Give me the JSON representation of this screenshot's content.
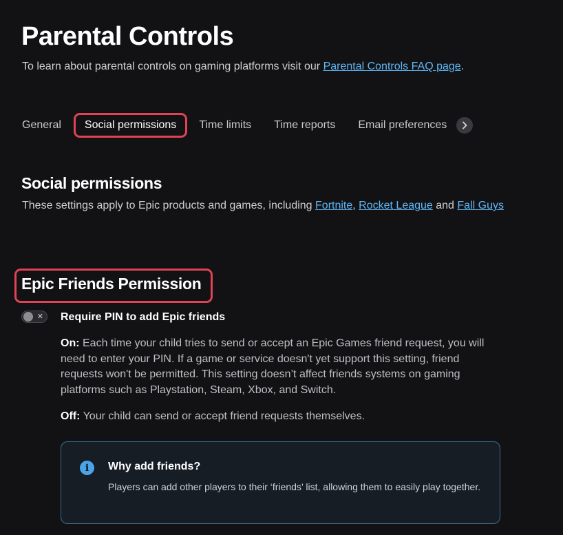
{
  "header": {
    "title": "Parental Controls",
    "intro_text": "To learn about parental controls on gaming platforms visit our ",
    "intro_link": "Parental Controls FAQ page",
    "intro_end": "."
  },
  "tabs": [
    {
      "label": "General",
      "active": false
    },
    {
      "label": "Social permissions",
      "active": true
    },
    {
      "label": "Time limits",
      "active": false
    },
    {
      "label": "Time reports",
      "active": false
    },
    {
      "label": "Email preferences",
      "active": false
    }
  ],
  "tab_next_icon": "chevron-right-icon",
  "social": {
    "title": "Social permissions",
    "desc_prefix": "These settings apply to Epic products and games, including ",
    "link_fortnite": "Fortnite",
    "sep_comma": ", ",
    "link_rocket_league": "Rocket League",
    "sep_and": " and ",
    "link_fall_guys": "Fall Guys"
  },
  "epic_friends": {
    "title": "Epic Friends Permission",
    "toggle_label": "Require PIN to add Epic friends",
    "toggle_state": "off",
    "on_label": "On:",
    "on_text": " Each time your child tries to send or accept an Epic Games friend request, you will need to enter your PIN. If a game or service doesn't yet support this setting, friend requests won't be permitted. This setting doesn’t affect friends systems on gaming platforms such as Playstation, Steam, Xbox, and Switch.",
    "off_label": "Off:",
    "off_text": " Your child can send or accept friend requests themselves."
  },
  "info_card": {
    "icon": "info-icon",
    "title": "Why add friends?",
    "body": "Players can add other players to their ‘friends’ list, allowing them to easily play together."
  },
  "colors": {
    "background": "#121214",
    "link": "#5fb6f5",
    "highlight": "#e04356",
    "info_border": "#3f6d8e",
    "info_icon": "#4ba3e8"
  }
}
